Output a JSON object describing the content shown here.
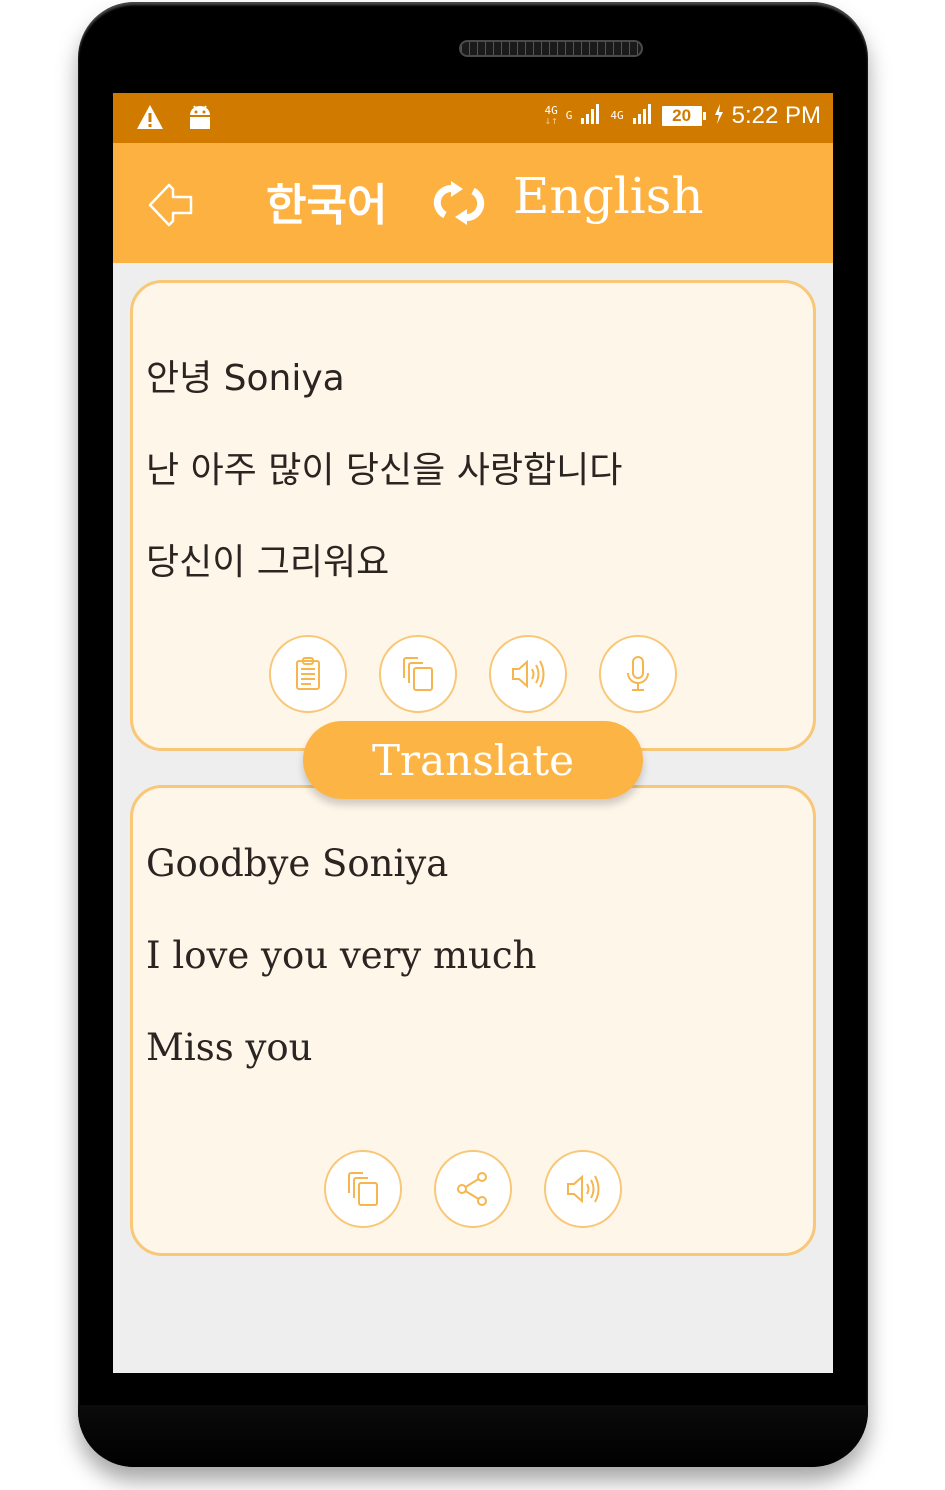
{
  "status_bar": {
    "left_icons": [
      "warning-icon",
      "android-icon"
    ],
    "network_labels": [
      "4G",
      "G",
      "4G"
    ],
    "battery_level": "20",
    "charging": true,
    "time": "5:22 PM"
  },
  "app_bar": {
    "back_icon": "back-arrow-icon",
    "source_language": "한국어",
    "swap_icon": "swap-languages-icon",
    "target_language": "English"
  },
  "source_card": {
    "text": "안녕 Soniya\n난 아주 많이 당신을 사랑합니다\n당신이 그리워요",
    "actions": [
      {
        "name": "paste",
        "icon": "clipboard-icon"
      },
      {
        "name": "copy",
        "icon": "copy-icon"
      },
      {
        "name": "speak",
        "icon": "speaker-icon"
      },
      {
        "name": "voice-input",
        "icon": "microphone-icon"
      }
    ]
  },
  "translate_button": {
    "label": "Translate"
  },
  "target_card": {
    "text": "Goodbye Soniya\nI love you very much\nMiss you",
    "actions": [
      {
        "name": "copy",
        "icon": "copy-icon"
      },
      {
        "name": "share",
        "icon": "share-icon"
      },
      {
        "name": "speak",
        "icon": "speaker-icon"
      }
    ]
  },
  "colors": {
    "status_bar": "#d07b00",
    "app_bar": "#fcb141",
    "accent": "#fcb545",
    "card_bg": "#fff6ea",
    "card_border": "#f8c777",
    "icon_stroke": "#f6b54e",
    "screen_bg": "#eeeeee"
  }
}
